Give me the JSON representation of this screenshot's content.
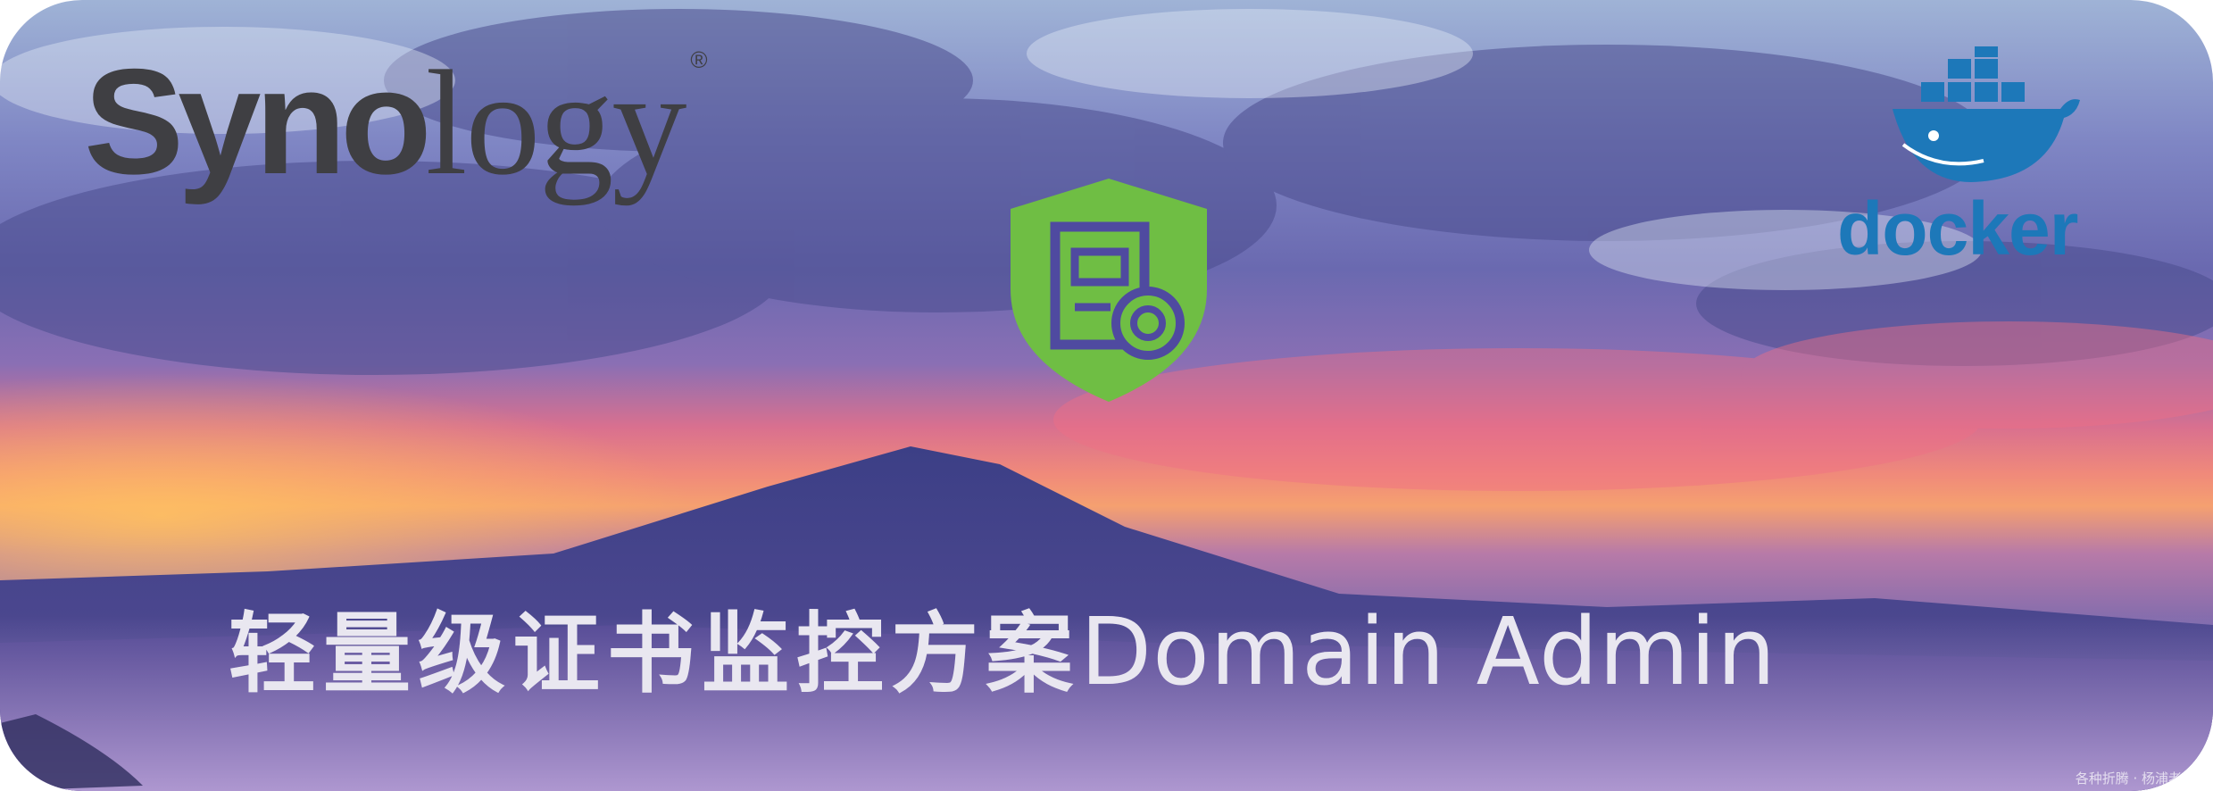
{
  "logos": {
    "synology_bold": "Syno",
    "synology_thin": "logy",
    "synology_mark": "®",
    "docker": "docker"
  },
  "headline": {
    "chinese": "轻量级证书监控方案",
    "english": "Domain Admin"
  },
  "watermark": "各种折腾 · 杨浦老苏",
  "colors": {
    "shield_green": "#6fbe44",
    "docker_blue": "#1d78b9",
    "synology_gray": "#3f3f43"
  },
  "icons": [
    "certificate-shield-icon",
    "docker-whale-icon"
  ]
}
